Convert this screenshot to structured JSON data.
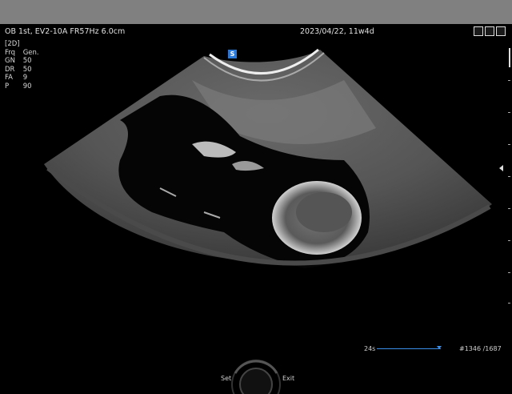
{
  "header": {
    "left_info": "OB  1st,  EV2-10A  FR57Hz  6.0cm",
    "date_info": "2023/04/22, 11w4d"
  },
  "params": {
    "mode": "2D",
    "rows": [
      {
        "key": "Frq",
        "value": "Gen."
      },
      {
        "key": "GN",
        "value": "50"
      },
      {
        "key": "DR",
        "value": "50"
      },
      {
        "key": "FA",
        "value": "9"
      },
      {
        "key": "P",
        "value": "90"
      }
    ]
  },
  "probe_marker": "S",
  "cine": {
    "time": "24s",
    "frame": "#1346 /1687",
    "position_fraction": 0.94
  },
  "controls": {
    "set_label": "Set",
    "exit_label": "Exit"
  },
  "colors": {
    "topbar": "#808080",
    "accent": "#3a8ee8",
    "background": "#000000"
  },
  "icons": [
    "image-icon",
    "settings-icon",
    "print-icon"
  ]
}
